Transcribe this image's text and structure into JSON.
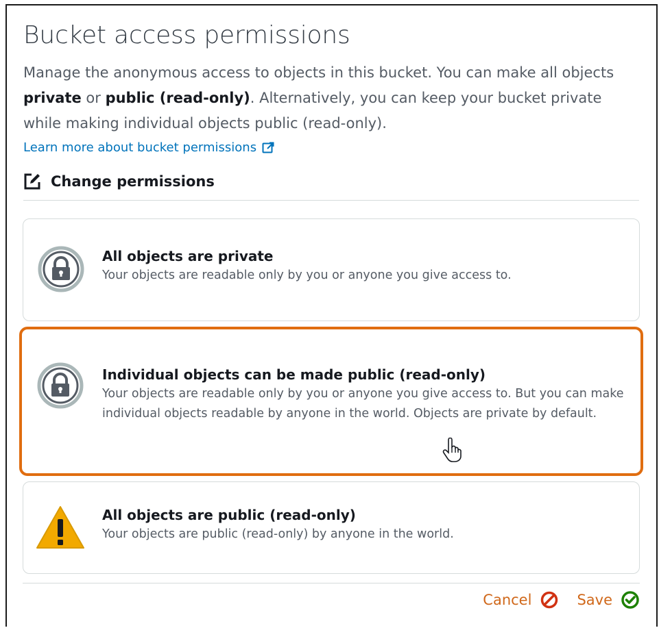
{
  "title": "Bucket access permissions",
  "description": {
    "part1": "Manage the anonymous access to objects in this bucket. You can make all objects ",
    "private": "private",
    "or": " or ",
    "public": "public (read-only)",
    "part2": ". Alternatively, you can keep your bucket private while making individual objects public (read-only)."
  },
  "learn_more": "Learn more about bucket permissions",
  "change_permissions": "Change permissions",
  "options": [
    {
      "title": "All objects are private",
      "description": "Your objects are readable only by you or anyone you give access to.",
      "icon": "lock-icon",
      "selected": false
    },
    {
      "title": "Individual objects can be made public (read-only)",
      "description": "Your objects are readable only by you or anyone you give access to. But you can make individual objects readable by anyone in the world. Objects are private by default.",
      "icon": "lock-icon",
      "selected": true
    },
    {
      "title": "All objects are public (read-only)",
      "description": "Your objects are public (read-only) by anyone in the world.",
      "icon": "warning-icon",
      "selected": false
    }
  ],
  "actions": {
    "cancel": "Cancel",
    "save": "Save"
  },
  "colors": {
    "accent": "#e06d10",
    "link": "#0073bb",
    "save_check": "#1d8102",
    "cancel_icon": "#d13212",
    "warning": "#f2a900"
  }
}
